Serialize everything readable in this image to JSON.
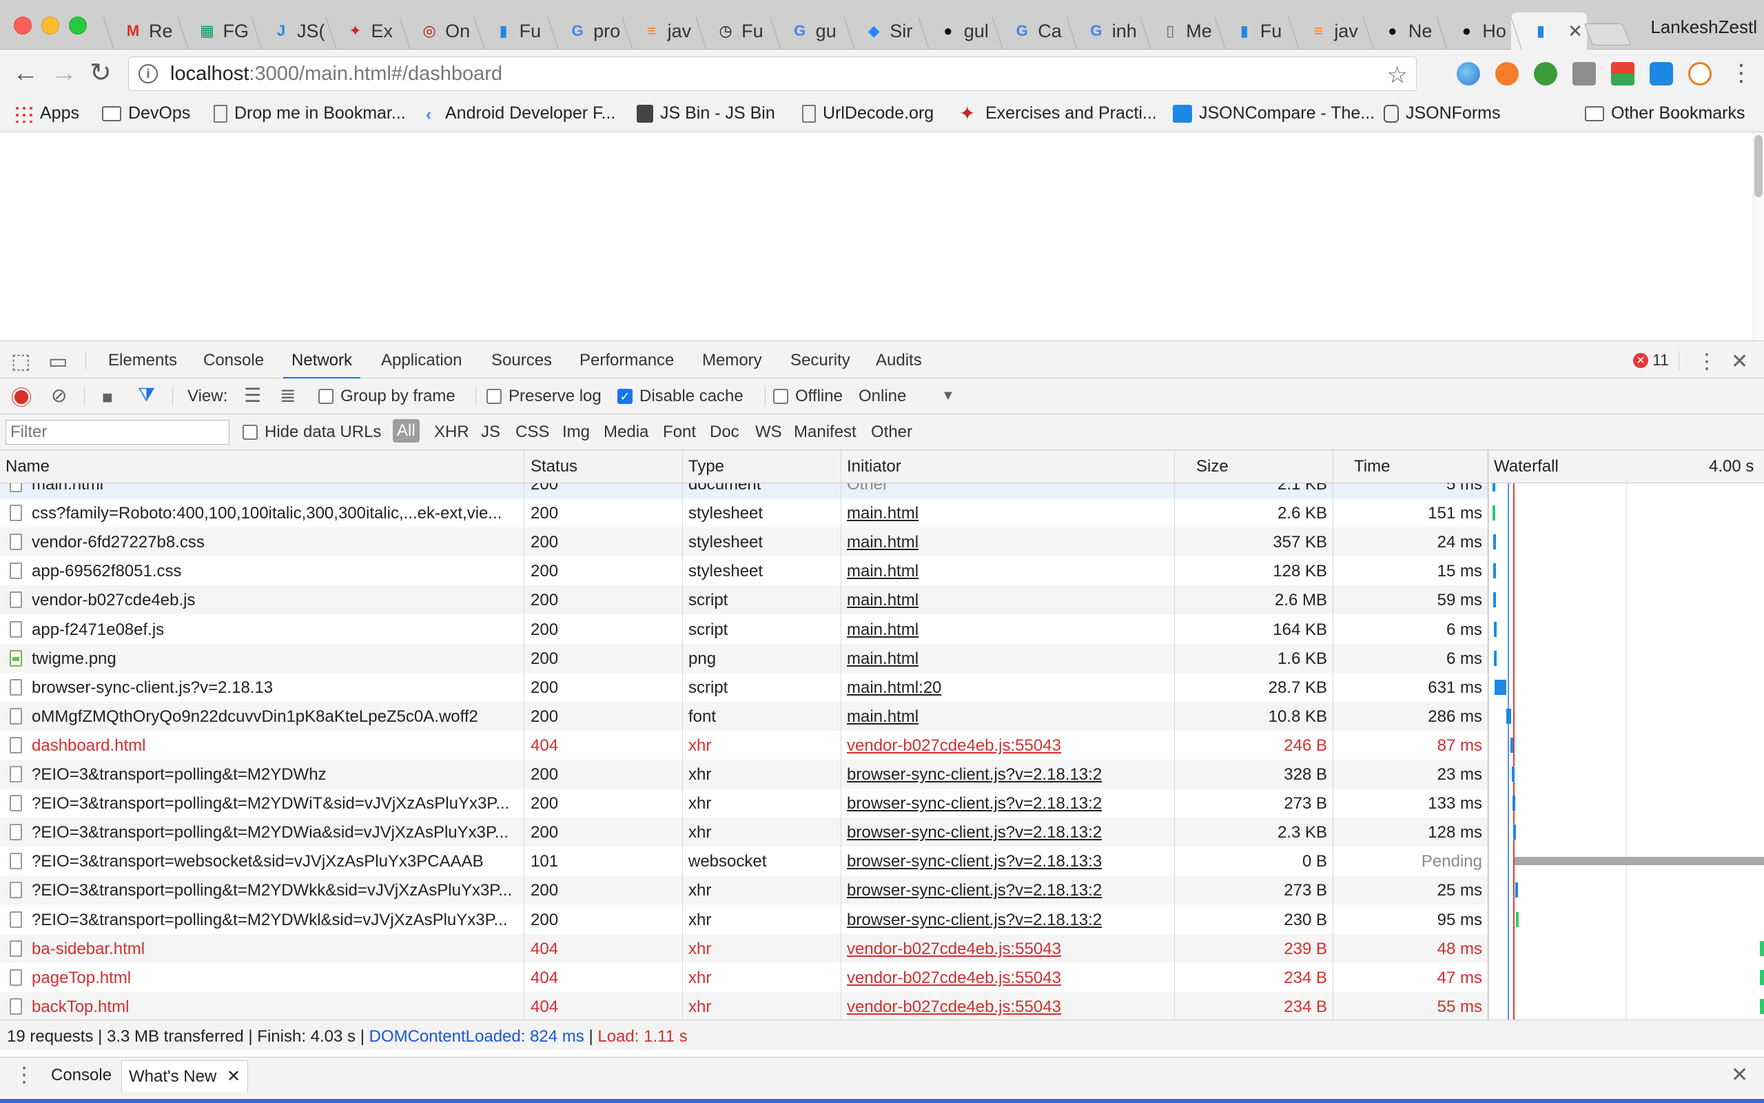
{
  "browser": {
    "tabs": [
      {
        "label": "Re",
        "icon": "gmail-icon",
        "color": "#d93025",
        "glyph": "M"
      },
      {
        "label": "FG",
        "icon": "sheets-icon",
        "color": "#0f9d58",
        "glyph": "▦"
      },
      {
        "label": "JS(",
        "icon": "json-icon",
        "color": "#1e88e5",
        "glyph": "J"
      },
      {
        "label": "Ex",
        "icon": "dragon-icon",
        "color": "#c62828",
        "glyph": "✦"
      },
      {
        "label": "On",
        "icon": "opera-icon",
        "color": "#b71c1c",
        "glyph": "◎"
      },
      {
        "label": "Fu",
        "icon": "chart-icon",
        "color": "#1e88e5",
        "glyph": "▮"
      },
      {
        "label": "pro",
        "icon": "google-icon",
        "color": "#4285f4",
        "glyph": "G"
      },
      {
        "label": "jav",
        "icon": "stackoverflow-icon",
        "color": "#f48024",
        "glyph": "≡"
      },
      {
        "label": "Fu",
        "icon": "stopwatch-icon",
        "color": "#111111",
        "glyph": "◷"
      },
      {
        "label": "gu",
        "icon": "google-icon",
        "color": "#4285f4",
        "glyph": "G"
      },
      {
        "label": "Sir",
        "icon": "jira-icon",
        "color": "#2684ff",
        "glyph": "◆"
      },
      {
        "label": "gul",
        "icon": "github-icon",
        "color": "#111111",
        "glyph": "●"
      },
      {
        "label": "Ca",
        "icon": "google-icon",
        "color": "#4285f4",
        "glyph": "G"
      },
      {
        "label": "inh",
        "icon": "google-icon",
        "color": "#4285f4",
        "glyph": "G"
      },
      {
        "label": "Me",
        "icon": "document-icon",
        "color": "#666666",
        "glyph": "▯"
      },
      {
        "label": "Fu",
        "icon": "chart-icon",
        "color": "#1e88e5",
        "glyph": "▮"
      },
      {
        "label": "jav",
        "icon": "stackoverflow-icon",
        "color": "#f48024",
        "glyph": "≡"
      },
      {
        "label": "Ne",
        "icon": "github-icon",
        "color": "#111111",
        "glyph": "●"
      },
      {
        "label": "Ho",
        "icon": "github-icon",
        "color": "#111111",
        "glyph": "●"
      },
      {
        "label": "",
        "icon": "chart-icon",
        "color": "#1e88e5",
        "glyph": "▮",
        "active": true
      }
    ],
    "profile_name": "LankeshZestl",
    "url_host": "localhost",
    "url_rest": ":3000/main.html#/dashboard",
    "bookmarks": [
      {
        "label": "Apps",
        "icon": "apps-icon"
      },
      {
        "label": "DevOps",
        "icon": "folder-icon"
      },
      {
        "label": "Drop me in Bookmar...",
        "icon": "page-icon"
      },
      {
        "label": "Android Developer F...",
        "icon": "android-icon"
      },
      {
        "label": "JS Bin - JS Bin",
        "icon": "jsbin-icon"
      },
      {
        "label": "UrlDecode.org",
        "icon": "page-icon"
      },
      {
        "label": "Exercises and Practi...",
        "icon": "dragon-icon"
      },
      {
        "label": "JSONCompare - The...",
        "icon": "json-icon"
      },
      {
        "label": "JSONForms",
        "icon": "jsonforms-icon"
      },
      {
        "label": "Other Bookmarks",
        "icon": "folder-icon"
      }
    ]
  },
  "devtools": {
    "tabs": [
      "Elements",
      "Console",
      "Network",
      "Application",
      "Sources",
      "Performance",
      "Memory",
      "Security",
      "Audits"
    ],
    "active_tab": "Network",
    "error_count": "11",
    "toolbar": {
      "view_label": "View:",
      "group_by_frame": "Group by frame",
      "preserve_log": "Preserve log",
      "disable_cache": "Disable cache",
      "offline": "Offline",
      "throttle": "Online"
    },
    "filter": {
      "placeholder": "Filter",
      "hide_data_urls": "Hide data URLs",
      "types": [
        "All",
        "XHR",
        "JS",
        "CSS",
        "Img",
        "Media",
        "Font",
        "Doc",
        "WS",
        "Manifest",
        "Other"
      ]
    },
    "columns": {
      "name": "Name",
      "status": "Status",
      "type": "Type",
      "initiator": "Initiator",
      "size": "Size",
      "time": "Time",
      "waterfall": "Waterfall",
      "waterfall_scale": "4.00 s"
    },
    "requests": [
      {
        "name": "main.html",
        "status": "200",
        "type": "document",
        "initiator": "Other",
        "size": "2.1 KB",
        "time": "5 ms",
        "partial": true
      },
      {
        "name": "css?family=Roboto:400,100,100italic,300,300italic,...ek-ext,vie...",
        "status": "200",
        "type": "stylesheet",
        "initiator": "main.html",
        "size": "2.6 KB",
        "time": "151 ms"
      },
      {
        "name": "vendor-6fd27227b8.css",
        "status": "200",
        "type": "stylesheet",
        "initiator": "main.html",
        "size": "357 KB",
        "time": "24 ms"
      },
      {
        "name": "app-69562f8051.css",
        "status": "200",
        "type": "stylesheet",
        "initiator": "main.html",
        "size": "128 KB",
        "time": "15 ms"
      },
      {
        "name": "vendor-b027cde4eb.js",
        "status": "200",
        "type": "script",
        "initiator": "main.html",
        "size": "2.6 MB",
        "time": "59 ms"
      },
      {
        "name": "app-f2471e08ef.js",
        "status": "200",
        "type": "script",
        "initiator": "main.html",
        "size": "164 KB",
        "time": "6 ms"
      },
      {
        "name": "twigme.png",
        "status": "200",
        "type": "png",
        "initiator": "main.html",
        "size": "1.6 KB",
        "time": "6 ms",
        "image": true
      },
      {
        "name": "browser-sync-client.js?v=2.18.13",
        "status": "200",
        "type": "script",
        "initiator": "main.html:20",
        "size": "28.7 KB",
        "time": "631 ms"
      },
      {
        "name": "oMMgfZMQthOryQo9n22dcuvvDin1pK8aKteLpeZ5c0A.woff2",
        "status": "200",
        "type": "font",
        "initiator": "main.html",
        "size": "10.8 KB",
        "time": "286 ms"
      },
      {
        "name": "dashboard.html",
        "status": "404",
        "type": "xhr",
        "initiator": "vendor-b027cde4eb.js:55043",
        "size": "246 B",
        "time": "87 ms",
        "error": true
      },
      {
        "name": "?EIO=3&transport=polling&t=M2YDWhz",
        "status": "200",
        "type": "xhr",
        "initiator": "browser-sync-client.js?v=2.18.13:2",
        "size": "328 B",
        "time": "23 ms"
      },
      {
        "name": "?EIO=3&transport=polling&t=M2YDWiT&sid=vJVjXzAsPluYx3P...",
        "status": "200",
        "type": "xhr",
        "initiator": "browser-sync-client.js?v=2.18.13:2",
        "size": "273 B",
        "time": "133 ms"
      },
      {
        "name": "?EIO=3&transport=polling&t=M2YDWia&sid=vJVjXzAsPluYx3P...",
        "status": "200",
        "type": "xhr",
        "initiator": "browser-sync-client.js?v=2.18.13:2",
        "size": "2.3 KB",
        "time": "128 ms"
      },
      {
        "name": "?EIO=3&transport=websocket&sid=vJVjXzAsPluYx3PCAAAB",
        "status": "101",
        "type": "websocket",
        "initiator": "browser-sync-client.js?v=2.18.13:3",
        "size": "0 B",
        "time": "Pending",
        "pending": true
      },
      {
        "name": "?EIO=3&transport=polling&t=M2YDWkk&sid=vJVjXzAsPluYx3P...",
        "status": "200",
        "type": "xhr",
        "initiator": "browser-sync-client.js?v=2.18.13:2",
        "size": "273 B",
        "time": "25 ms"
      },
      {
        "name": "?EIO=3&transport=polling&t=M2YDWkl&sid=vJVjXzAsPluYx3P...",
        "status": "200",
        "type": "xhr",
        "initiator": "browser-sync-client.js?v=2.18.13:2",
        "size": "230 B",
        "time": "95 ms"
      },
      {
        "name": "ba-sidebar.html",
        "status": "404",
        "type": "xhr",
        "initiator": "vendor-b027cde4eb.js:55043",
        "size": "239 B",
        "time": "48 ms",
        "error": true
      },
      {
        "name": "pageTop.html",
        "status": "404",
        "type": "xhr",
        "initiator": "vendor-b027cde4eb.js:55043",
        "size": "234 B",
        "time": "47 ms",
        "error": true
      },
      {
        "name": "backTop.html",
        "status": "404",
        "type": "xhr",
        "initiator": "vendor-b027cde4eb.js:55043",
        "size": "234 B",
        "time": "55 ms",
        "error": true
      }
    ],
    "waterfall": {
      "scale_seconds": 4.0,
      "dom_content_loaded_s": 0.824,
      "load_s": 1.11,
      "bars": [
        {
          "start": 0.0,
          "end": 0.005,
          "color": "#1e88e5"
        },
        {
          "start": 0.01,
          "end": 0.161,
          "color": "#2ecc71"
        },
        {
          "start": 0.02,
          "end": 0.044,
          "color": "#1e88e5"
        },
        {
          "start": 0.02,
          "end": 0.035,
          "color": "#1e88e5"
        },
        {
          "start": 0.04,
          "end": 0.099,
          "color": "#1e88e5"
        },
        {
          "start": 0.06,
          "end": 0.066,
          "color": "#1e88e5"
        },
        {
          "start": 0.07,
          "end": 0.076,
          "color": "#1e88e5"
        },
        {
          "start": 0.12,
          "end": 0.751,
          "color": "#1e88e5"
        },
        {
          "start": 0.74,
          "end": 1.026,
          "color": "#1e88e5"
        },
        {
          "start": 0.98,
          "end": 1.067,
          "color": "#1e88e5"
        },
        {
          "start": 1.07,
          "end": 1.093,
          "color": "#1e88e5"
        },
        {
          "start": 1.1,
          "end": 1.233,
          "color": "#1e88e5"
        },
        {
          "start": 1.12,
          "end": 1.248,
          "color": "#1e88e5"
        },
        {
          "start": 1.22,
          "end": 4.2,
          "color": "#a8a8a8"
        },
        {
          "start": 1.24,
          "end": 1.265,
          "color": "#1e88e5"
        },
        {
          "start": 1.27,
          "end": 1.365,
          "color": "#2ecc71"
        },
        {
          "start": 3.98,
          "end": 4.028,
          "color": "#2ecc71"
        },
        {
          "start": 3.98,
          "end": 4.027,
          "color": "#2ecc71"
        },
        {
          "start": 3.98,
          "end": 4.035,
          "color": "#2ecc71"
        }
      ]
    },
    "summary": {
      "main": "19 requests | 3.3 MB transferred | Finish: 4.03 s | ",
      "dom": "DOMContentLoaded: 824 ms",
      "sep": " | ",
      "load": "Load: 1.11 s"
    },
    "drawer": {
      "tabs": [
        "Console",
        "What's New"
      ],
      "active_tab": "What's New"
    }
  },
  "colors": {
    "accent": "#1a73e8",
    "error": "#d32f2f",
    "dom_line": "#5b8ff9",
    "load_line": "#e53935"
  }
}
